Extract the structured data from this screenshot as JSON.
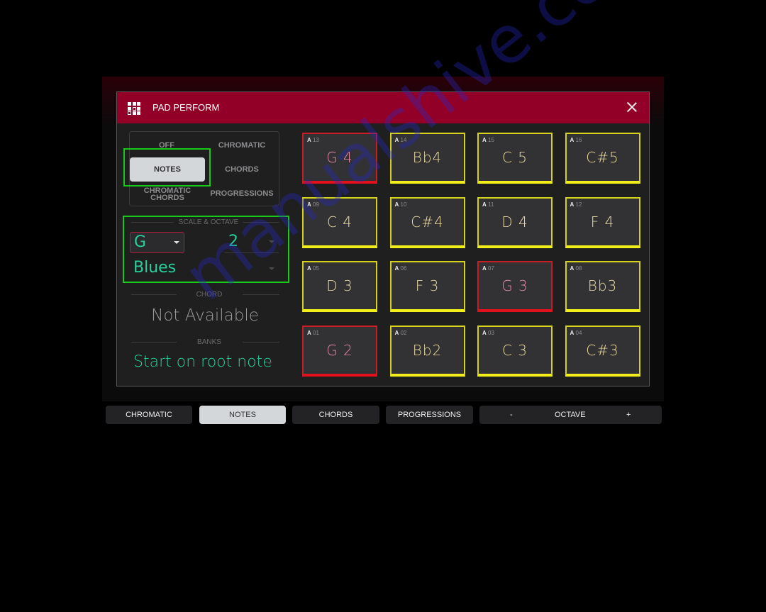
{
  "header": {
    "title": "PAD PERFORM",
    "icon": "pad-grid-icon",
    "close_icon": "close-icon"
  },
  "mode": {
    "options": [
      "OFF",
      "CHROMATIC",
      "NOTES",
      "CHORDS",
      "CHROMATIC CHORDS",
      "PROGRESSIONS"
    ],
    "off": "OFF",
    "chromatic": "CHROMATIC",
    "notes": "NOTES",
    "chords": "CHORDS",
    "chromatic_chords_line1": "CHROMATIC",
    "chromatic_chords_line2": "CHORDS",
    "progressions": "PROGRESSIONS",
    "selected": "NOTES"
  },
  "scale_octave": {
    "label": "SCALE & OCTAVE",
    "root": "G",
    "octave": "2",
    "scale": "Blues"
  },
  "chord": {
    "label": "CHORD",
    "value": "Not Available"
  },
  "banks": {
    "label": "BANKS",
    "value": "Start on root note"
  },
  "pads": [
    {
      "bank": "A",
      "num": "13",
      "note": "G 4",
      "root": true
    },
    {
      "bank": "A",
      "num": "14",
      "note": "Bb4",
      "root": false
    },
    {
      "bank": "A",
      "num": "15",
      "note": "C 5",
      "root": false
    },
    {
      "bank": "A",
      "num": "16",
      "note": "C#5",
      "root": false
    },
    {
      "bank": "A",
      "num": "09",
      "note": "C 4",
      "root": false
    },
    {
      "bank": "A",
      "num": "10",
      "note": "C#4",
      "root": false
    },
    {
      "bank": "A",
      "num": "11",
      "note": "D 4",
      "root": false
    },
    {
      "bank": "A",
      "num": "12",
      "note": "F 4",
      "root": false
    },
    {
      "bank": "A",
      "num": "05",
      "note": "D 3",
      "root": false
    },
    {
      "bank": "A",
      "num": "06",
      "note": "F 3",
      "root": false
    },
    {
      "bank": "A",
      "num": "07",
      "note": "G 3",
      "root": true
    },
    {
      "bank": "A",
      "num": "08",
      "note": "Bb3",
      "root": false
    },
    {
      "bank": "A",
      "num": "01",
      "note": "G 2",
      "root": true
    },
    {
      "bank": "A",
      "num": "02",
      "note": "Bb2",
      "root": false
    },
    {
      "bank": "A",
      "num": "03",
      "note": "C 3",
      "root": false
    },
    {
      "bank": "A",
      "num": "04",
      "note": "C#3",
      "root": false
    }
  ],
  "bottom_bar": {
    "chromatic": "CHROMATIC",
    "notes": "NOTES",
    "chords": "CHORDS",
    "progressions": "PROGRESSIONS",
    "octave_minus": "-",
    "octave_label": "OCTAVE",
    "octave_plus": "+",
    "active": "NOTES"
  },
  "colors": {
    "header": "#930027",
    "root_pad": "#c81d25",
    "scale_pad": "#d6d21c",
    "value_teal": "#27d09a",
    "highlight": "#17c81a"
  },
  "watermark": "manualshive.com"
}
